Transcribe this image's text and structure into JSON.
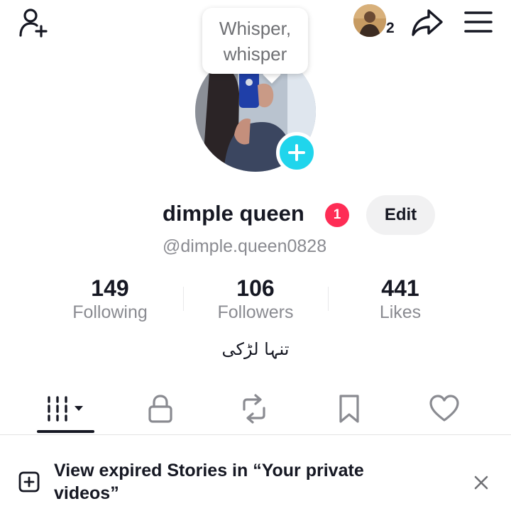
{
  "header": {
    "add_friend_icon": "person-plus-icon",
    "friend_count": "2",
    "share_icon": "share-arrow-icon",
    "menu_icon": "hamburger-menu-icon"
  },
  "tooltip": {
    "text_line1": "Whisper,",
    "text_line2": "whisper"
  },
  "profile": {
    "display_name": "dimple queen",
    "notification_count": "1",
    "edit_label": "Edit",
    "username": "@dimple.queen0828",
    "bio": "تنہا لڑکی"
  },
  "stats": [
    {
      "value": "149",
      "label": "Following"
    },
    {
      "value": "106",
      "label": "Followers"
    },
    {
      "value": "441",
      "label": "Likes"
    }
  ],
  "tabs": [
    {
      "name": "videos",
      "icon": "grid-icon",
      "active": true
    },
    {
      "name": "private",
      "icon": "lock-icon",
      "active": false
    },
    {
      "name": "reposts",
      "icon": "repost-icon",
      "active": false
    },
    {
      "name": "favorites",
      "icon": "bookmark-icon",
      "active": false
    },
    {
      "name": "liked",
      "icon": "heart-icon",
      "active": false
    }
  ],
  "banner": {
    "text": "View expired Stories in “Your private videos”"
  },
  "colors": {
    "accent_cyan": "#20d5ec",
    "badge_red": "#fe2c55",
    "text_primary": "#161823",
    "text_secondary": "#8a8b91"
  }
}
